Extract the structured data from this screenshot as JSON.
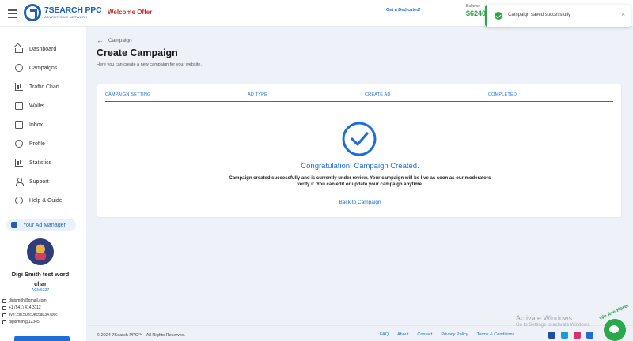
{
  "header": {
    "logo_text": "7SEARCH PPC",
    "logo_sub": "ADVERTISING NETWORK",
    "welcome": "Welcome Offer",
    "dedicated": "Get a Dedicated!",
    "balance_label": "Balance",
    "balance_value": "$6240"
  },
  "toast": {
    "message": "Campaign saved successfully",
    "close": "×",
    "accent": "#2ea44f"
  },
  "sidebar": {
    "items": [
      {
        "label": "Dashboard",
        "icon": "home-icon"
      },
      {
        "label": "Campaigns",
        "icon": "campaigns-icon"
      },
      {
        "label": "Traffic Chart",
        "icon": "chart-icon"
      },
      {
        "label": "Wallet",
        "icon": "wallet-icon"
      },
      {
        "label": "Inbox",
        "icon": "inbox-icon"
      },
      {
        "label": "Profile",
        "icon": "profile-icon"
      },
      {
        "label": "Statistics",
        "icon": "statistics-icon"
      },
      {
        "label": "Support",
        "icon": "support-icon"
      },
      {
        "label": "Help & Guide",
        "icon": "help-icon"
      }
    ],
    "ad_manager": "Your Ad Manager",
    "user": {
      "name": "Digi Smith test word char",
      "id": "AGM5337",
      "email": "digismith@gmail.com",
      "phone": "+1 (541) 414 3112",
      "skype": "live:.cid.502c0ec5a034706c",
      "telegram": "digismith@12345"
    }
  },
  "page": {
    "breadcrumb": "Campaign",
    "title": "Create Campaign",
    "subtitle": "Here you can create a new campaign for your website."
  },
  "steps": [
    "CAMPAIGN SETTING",
    "AD TYPE",
    "CREATE AD",
    "COMPLETED"
  ],
  "success": {
    "title": "Congratulation! Campaign Created.",
    "message": "Campaign created successfully and is currently under review. Your campaign will be live as soon as our moderators verify it. You can edit or update your campaign anytime.",
    "back": "Back to Campaign"
  },
  "footer": {
    "copyright": "© 2024 7Search PPC™ - All Rights Reserved.",
    "links": [
      "FAQ",
      "About",
      "Contact",
      "Privacy Policy",
      "Terms & Conditions"
    ]
  },
  "overlay": {
    "activate_title": "Activate Windows",
    "activate_sub": "Go to Settings to activate Windows.",
    "online": "We Are Here!"
  },
  "colors": {
    "primary": "#1d6fd6",
    "danger": "#c0322d",
    "success": "#2da44e"
  }
}
